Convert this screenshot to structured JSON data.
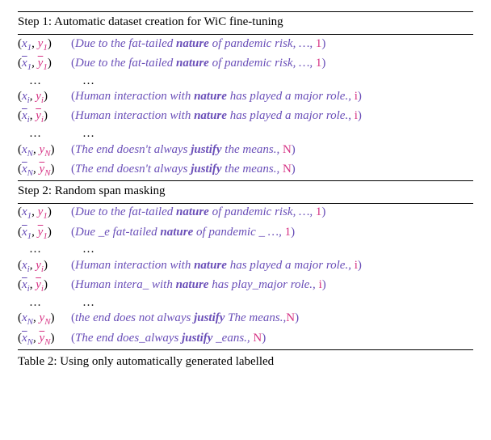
{
  "step1": {
    "title": "Step 1: Automatic dataset creation for WiC fine-tuning",
    "rows": [
      {
        "lhs_html": "(<span class='math-x'>x</span><span class='sub math-x'>1</span>, <span class='math-y'>y</span><span class='sub math-y'>1</span>)",
        "pre": "Due to the fat-tailed ",
        "kw": "nature",
        "post": " of pandemic risk, …, ",
        "label": "1"
      },
      {
        "lhs_html": "(<span class='math-x overline'>x</span><span class='sub math-x'>1</span>, <span class='math-y overline'>y</span><span class='sub math-y'>1</span>)",
        "pre": "Due to the fat-tailed ",
        "kw": "nature",
        "post": " of pandemic risk, …, ",
        "label": "1"
      },
      {
        "dots": true
      },
      {
        "lhs_html": "(<span class='math-x'>x</span><span class='sub math-x'>i</span>, <span class='math-y'>y</span><span class='sub math-y'>i</span>)",
        "pre": "Human interaction with ",
        "kw": "nature",
        "post": " has played a major role., ",
        "label": "i"
      },
      {
        "lhs_html": "(<span class='math-x overline'>x</span><span class='sub math-x'>i</span>, <span class='math-y overline'>y</span><span class='sub math-y'>i</span>)",
        "pre": "Human interaction with ",
        "kw": "nature",
        "post": " has played a major role., ",
        "label": "i"
      },
      {
        "dots": true
      },
      {
        "lhs_html": "(<span class='math-x'>x</span><span class='sub math-x'>N</span>, <span class='math-y'>y</span><span class='sub math-y'>N</span>)",
        "pre": "The end doesn't always ",
        "kw": "justify",
        "post": " the means., ",
        "label": "N"
      },
      {
        "lhs_html": "(<span class='math-x overline'>x</span><span class='sub math-x'>N</span>, <span class='math-y overline'>y</span><span class='sub math-y'>N</span>)",
        "pre": "The end doesn't always ",
        "kw": "justify",
        "post": " the means., ",
        "label": "N"
      }
    ]
  },
  "step2": {
    "title": "Step 2: Random span masking",
    "rows": [
      {
        "lhs_html": "(<span class='math-x'>x</span><span class='sub math-x'>1</span>, <span class='math-y'>y</span><span class='sub math-y'>1</span>)",
        "pre": "Due to the fat-tailed ",
        "kw": "nature",
        "post": " of pandemic risk, …, ",
        "label": "1"
      },
      {
        "lhs_html": "(<span class='math-x overline'>x</span><span class='sub math-x'>1</span>, <span class='math-y overline'>y</span><span class='sub math-y'>1</span>)",
        "pre": "Due _e fat-tailed ",
        "kw": "nature",
        "post": " of pandemic _ …, ",
        "label": "1"
      },
      {
        "dots": true
      },
      {
        "lhs_html": "(<span class='math-x'>x</span><span class='sub math-x'>i</span>, <span class='math-y'>y</span><span class='sub math-y'>i</span>)",
        "pre": "Human interaction with ",
        "kw": "nature",
        "post": " has played a major role., ",
        "label": "i"
      },
      {
        "lhs_html": "(<span class='math-x overline'>x</span><span class='sub math-x'>i</span>, <span class='math-y overline'>y</span><span class='sub math-y'>i</span>)",
        "pre": "Human intera_ with ",
        "kw": "nature",
        "post": " has play_major role., ",
        "label": "i"
      },
      {
        "dots": true
      },
      {
        "lhs_html": "(<span class='math-x'>x</span><span class='sub math-x'>N</span>, <span class='math-y'>y</span><span class='sub math-y'>N</span>)",
        "pre": "the end does not always ",
        "kw": "justify",
        "post": " The means.,",
        "label": "N"
      },
      {
        "lhs_html": "(<span class='math-x overline'>x</span><span class='sub math-x'>N</span>, <span class='math-y overline'>y</span><span class='sub math-y'>N</span>)",
        "pre": "The end does_always ",
        "kw": "justify",
        "post": " _eans., ",
        "label": "N"
      }
    ]
  },
  "caption_prefix": "Table 2: ",
  "caption_text": "Using only automatically generated labelled"
}
